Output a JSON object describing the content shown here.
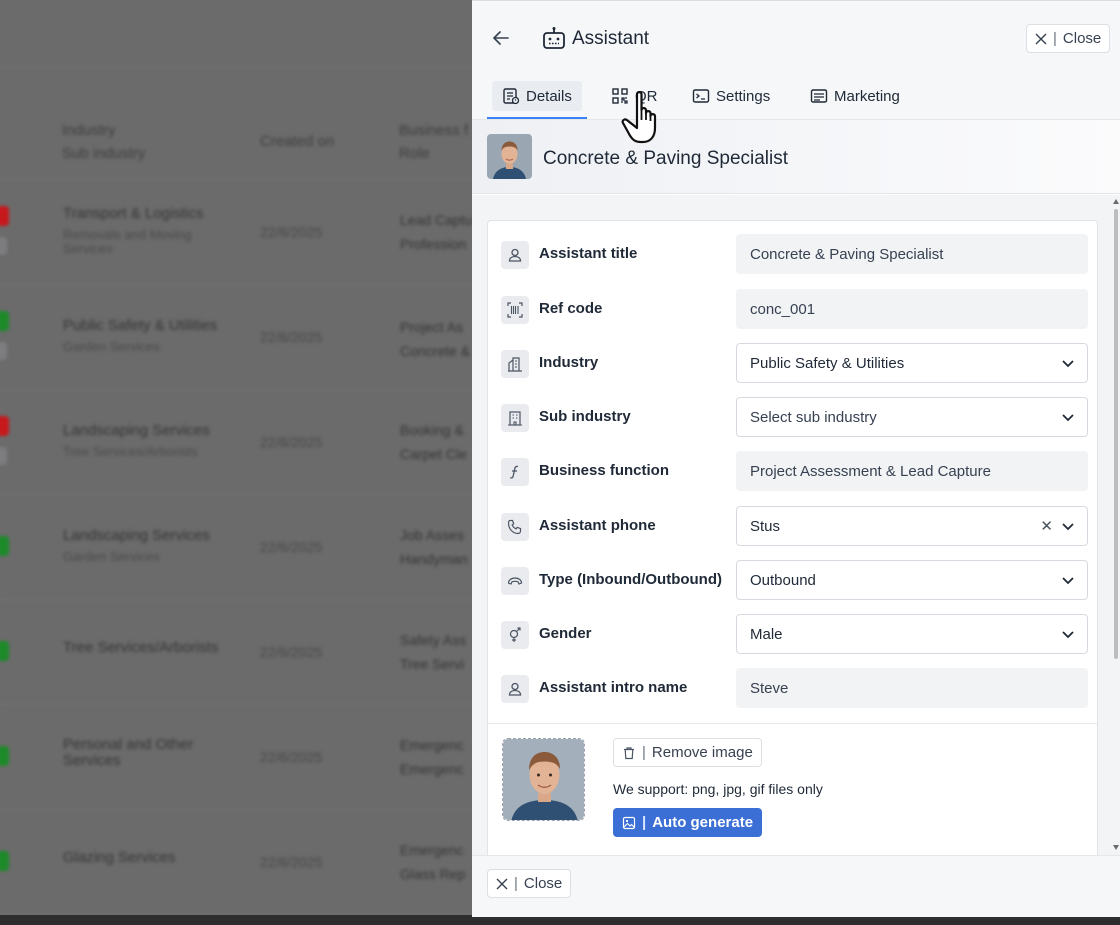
{
  "background_table": {
    "headers": [
      {
        "line1": "Industry",
        "line2": "Sub industry"
      },
      {
        "line1": "Created on",
        "line2": ""
      },
      {
        "line1": "Business f",
        "line2": "Role"
      }
    ],
    "rows": [
      {
        "industry": "Transport & Logistics",
        "sub": "Removals and Moving Services",
        "date": "22/6/2025",
        "role1": "Lead Captu",
        "role2": "Profession",
        "status": "#c7181c"
      },
      {
        "industry": "Public Safety & Utilities",
        "sub": "Garden Services",
        "date": "22/6/2025",
        "role1": "Project As",
        "role2": "Concrete &",
        "status": "#1d8a2a"
      },
      {
        "industry": "Landscaping Services",
        "sub": "Tree Services/Arborists",
        "date": "22/6/2025",
        "role1": "Booking &",
        "role2": "Carpet Cle",
        "status": "#c7181c"
      },
      {
        "industry": "Landscaping Services",
        "sub": "Garden Services",
        "date": "22/6/2025",
        "role1": "Job Asses",
        "role2": "Handyman",
        "status": "#1d8a2a"
      },
      {
        "industry": "Tree Services/Arborists",
        "sub": "",
        "date": "22/6/2025",
        "role1": "Safety Ass",
        "role2": "Tree Servi",
        "status": "#1d8a2a"
      },
      {
        "industry": "Personal and Other Services",
        "sub": "",
        "date": "22/6/2025",
        "role1": "Emergenc",
        "role2": "Emergenc",
        "status": "#1d8a2a"
      },
      {
        "industry": "Glazing Services",
        "sub": "",
        "date": "22/6/2025",
        "role1": "Emergenc",
        "role2": "Glass Rep",
        "status": "#1d8a2a"
      }
    ]
  },
  "panel": {
    "title": "Assistant",
    "close_label": "Close",
    "tabs": [
      {
        "label": "Details",
        "icon": "details-icon"
      },
      {
        "label": "QR",
        "icon": "qr-icon"
      },
      {
        "label": "Settings",
        "icon": "settings-icon"
      },
      {
        "label": "Marketing",
        "icon": "marketing-icon"
      }
    ],
    "active_tab": "Details",
    "profile_name": "Concrete & Paving Specialist",
    "fields": {
      "title": {
        "label": "Assistant title",
        "value": "Concrete & Paving Specialist"
      },
      "ref": {
        "label": "Ref code",
        "value": "conc_001"
      },
      "industry": {
        "label": "Industry",
        "value": "Public Safety & Utilities"
      },
      "sub_industry": {
        "label": "Sub industry",
        "placeholder": "Select sub industry"
      },
      "business_function": {
        "label": "Business function",
        "value": "Project Assessment & Lead Capture"
      },
      "phone": {
        "label": "Assistant phone",
        "value": "Stus",
        "clear": "✕"
      },
      "type": {
        "label": "Type (Inbound/Outbound)",
        "value": "Outbound"
      },
      "gender": {
        "label": "Gender",
        "value": "Male"
      },
      "intro_name": {
        "label": "Assistant intro name",
        "value": "Steve"
      }
    },
    "image": {
      "remove_label": "Remove image",
      "support_text": "We support: png, jpg, gif files only",
      "auto_label": "Auto generate"
    },
    "footer_close_label": "Close"
  },
  "colors": {
    "accent": "#3b82f6",
    "auto_button": "#3b6fd6",
    "status_red": "#c7181c",
    "status_green": "#1d8a2a"
  }
}
